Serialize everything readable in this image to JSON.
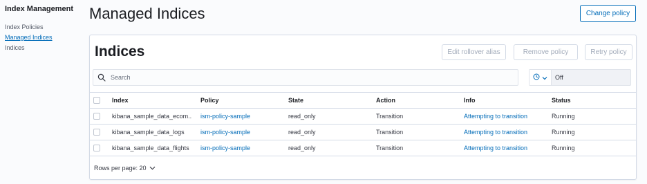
{
  "sidebar": {
    "title": "Index Management",
    "items": [
      {
        "label": "Index Policies",
        "active": false
      },
      {
        "label": "Managed Indices",
        "active": true
      },
      {
        "label": "Indices",
        "active": false
      }
    ]
  },
  "header": {
    "title": "Managed Indices",
    "change_policy_label": "Change policy"
  },
  "panel": {
    "title": "Indices",
    "buttons": {
      "edit_rollover": "Edit rollover alias",
      "remove_policy": "Remove policy",
      "retry_policy": "Retry policy"
    },
    "search": {
      "placeholder": "Search",
      "value": ""
    },
    "refresh": {
      "icon": "clock-icon",
      "value": "Off"
    }
  },
  "table": {
    "columns": [
      "Index",
      "Policy",
      "State",
      "Action",
      "Info",
      "Status"
    ],
    "rows": [
      {
        "index": "kibana_sample_data_ecom...",
        "policy": "ism-policy-sample",
        "state": "read_only",
        "action": "Transition",
        "info": "Attempting to transition",
        "status": "Running"
      },
      {
        "index": "kibana_sample_data_logs",
        "policy": "ism-policy-sample",
        "state": "read_only",
        "action": "Transition",
        "info": "Attempting to transition",
        "status": "Running"
      },
      {
        "index": "kibana_sample_data_flights",
        "policy": "ism-policy-sample",
        "state": "read_only",
        "action": "Transition",
        "info": "Attempting to transition",
        "status": "Running"
      }
    ]
  },
  "pagination": {
    "rows_per_page": "Rows per page: 20"
  },
  "colors": {
    "accent": "#006bb8",
    "border": "#d3dae6",
    "disabled_text": "#a2abba"
  }
}
